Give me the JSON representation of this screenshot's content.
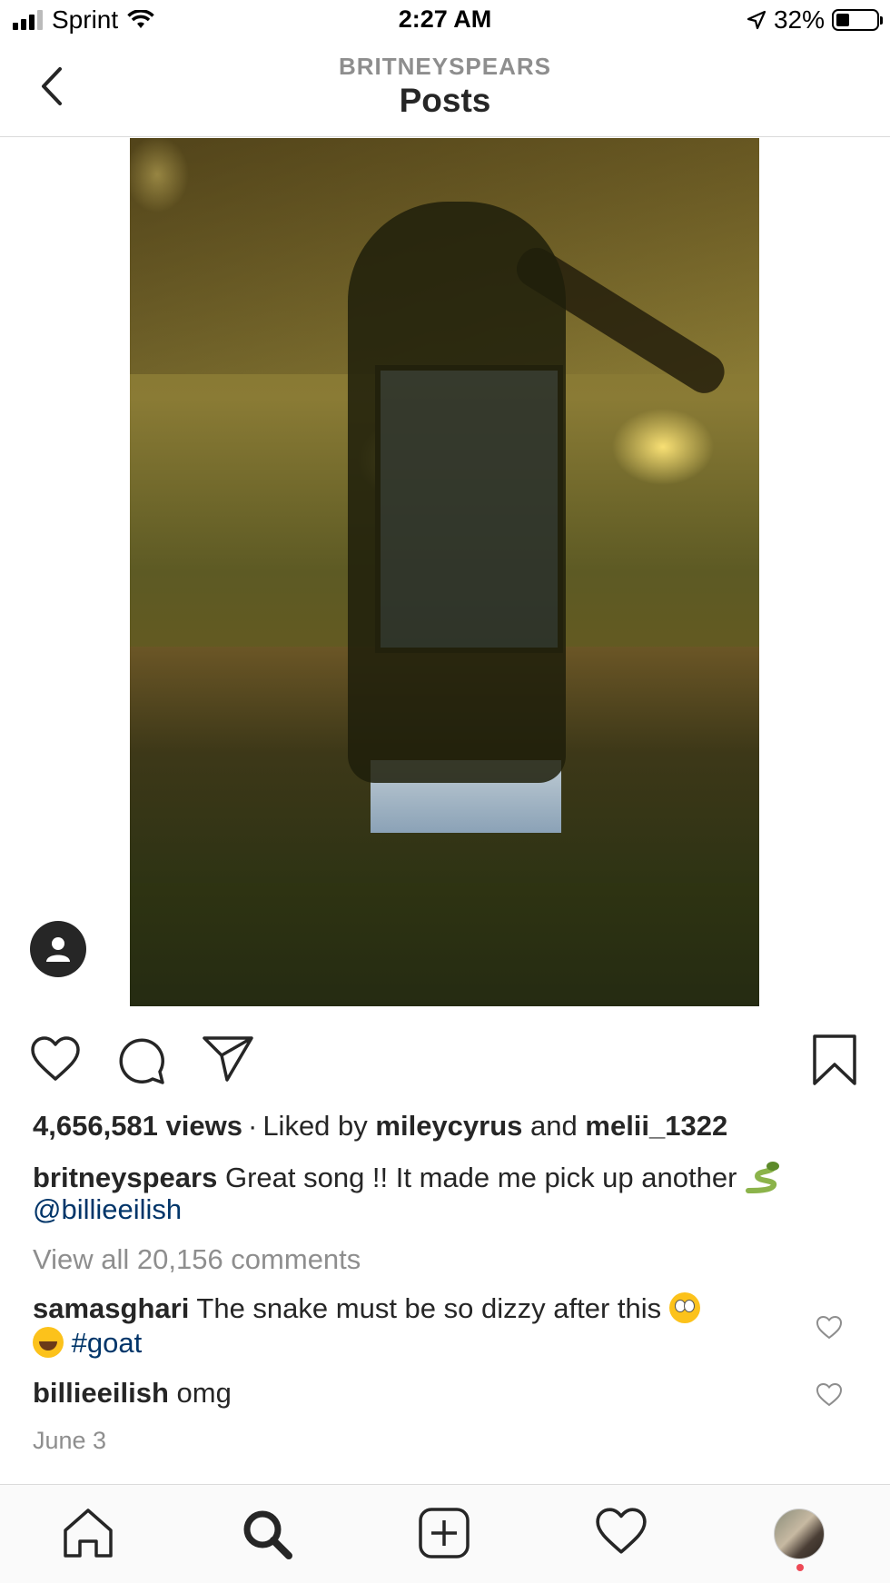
{
  "status_bar": {
    "carrier": "Sprint",
    "time": "2:27 AM",
    "battery": "32%"
  },
  "header": {
    "subtitle": "BRITNEYSPEARS",
    "title": "Posts"
  },
  "post": {
    "views": "4,656,581 views",
    "liked_by_prefix": "Liked by",
    "liker1": "mileycyrus",
    "and": "and",
    "liker2": "melii_1322",
    "caption_user": "britneyspears",
    "caption_text": "Great song !! It made me pick up another",
    "caption_mention": "@billieeilish",
    "view_all": "View all 20,156 comments",
    "comments": [
      {
        "user": "samasghari",
        "text": "The snake must be so dizzy after this",
        "hashtag": "#goat"
      },
      {
        "user": "billieeilish",
        "text": "omg"
      }
    ],
    "date": "June 3"
  },
  "icons": {
    "back": "chevron-left-icon",
    "like": "heart-icon",
    "comment": "speech-bubble-icon",
    "share": "paper-plane-icon",
    "save": "bookmark-icon",
    "home": "home-icon",
    "search": "search-icon",
    "add": "plus-square-icon",
    "activity": "heart-icon",
    "tag": "user-tag-icon"
  },
  "colors": {
    "link": "#003569",
    "muted": "#8e8e8e",
    "text": "#262626",
    "notification": "#ed4956"
  }
}
